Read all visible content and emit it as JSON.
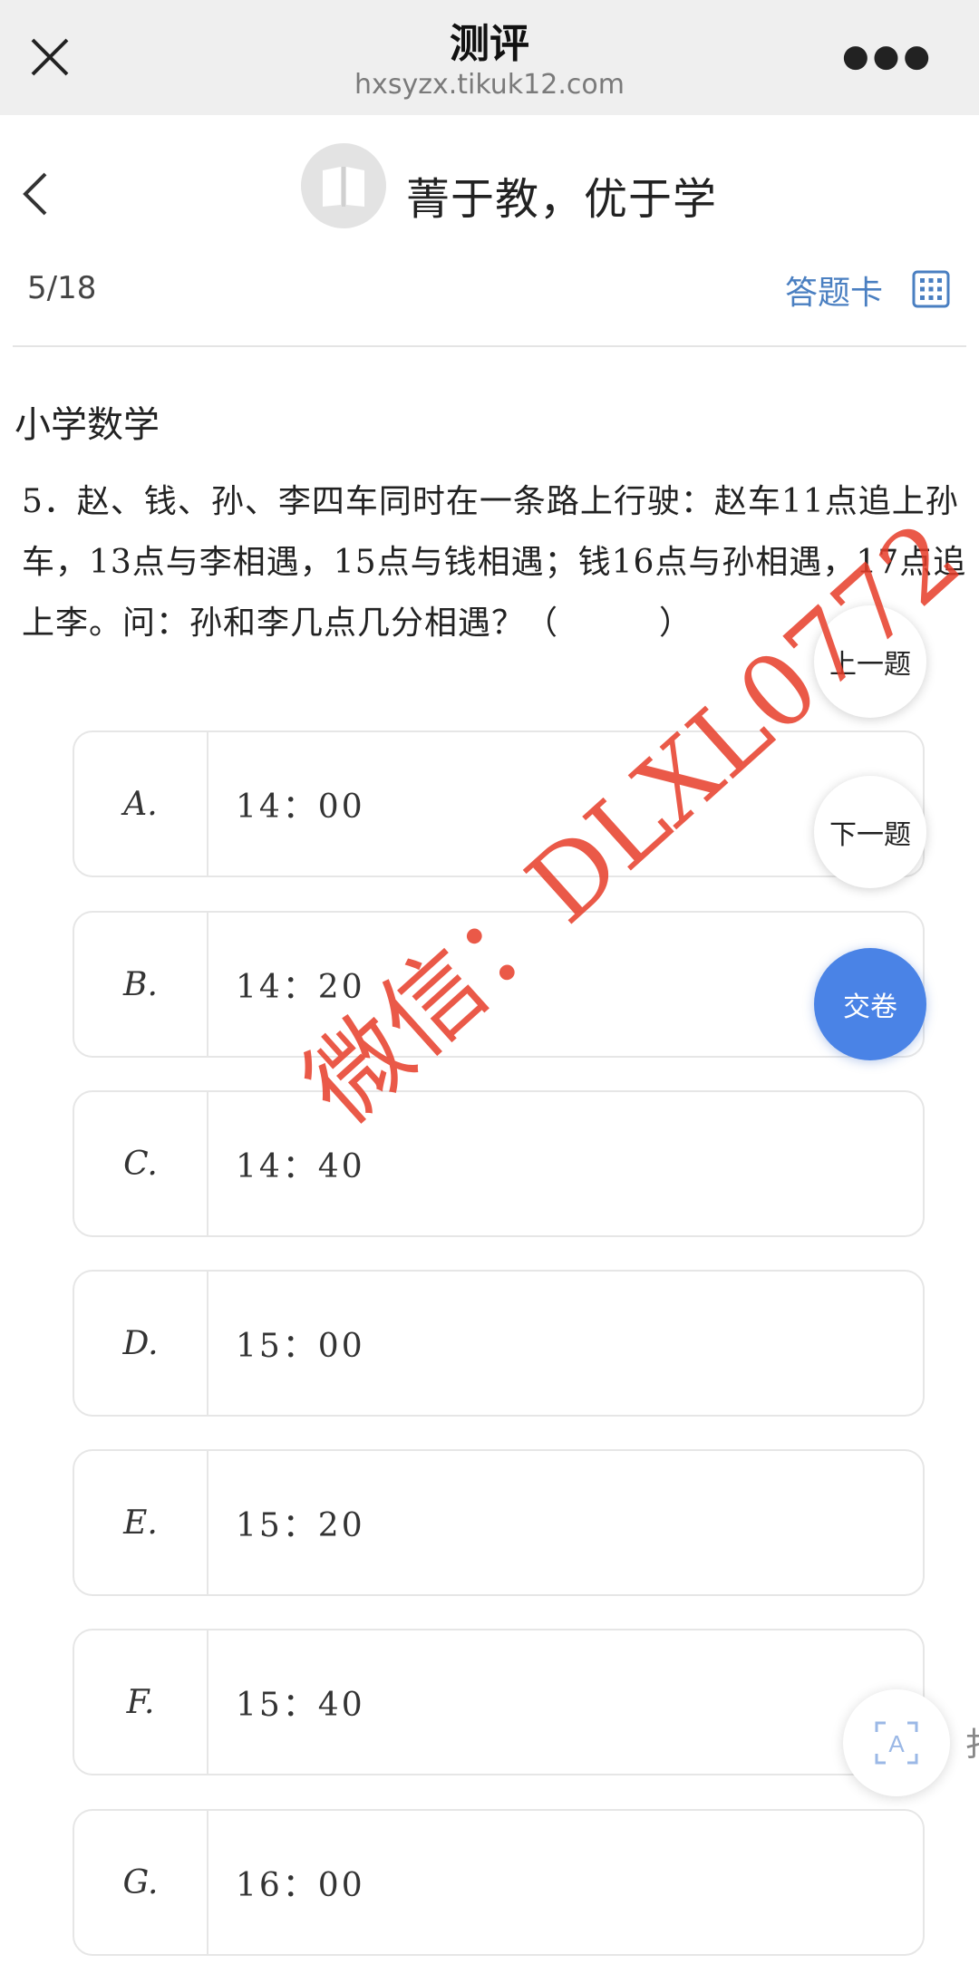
{
  "browser": {
    "title": "测评",
    "url": "hxsyzx.tikuk12.com"
  },
  "header": {
    "slogan": "菁于教，优于学"
  },
  "progress": {
    "current": 5,
    "total": 18,
    "text": "5/18",
    "answer_card_label": "答题卡"
  },
  "subject": "小学数学",
  "question": {
    "text": "5．赵、钱、孙、李四车同时在一条路上行驶：赵车11点追上孙车，13点与李相遇，15点与钱相遇；钱16点与孙相遇，17点追上李。问：孙和李几点几分相遇？（　　　）"
  },
  "options": [
    {
      "letter": "A.",
      "text": "14：00"
    },
    {
      "letter": "B.",
      "text": "14：20"
    },
    {
      "letter": "C.",
      "text": "14：40"
    },
    {
      "letter": "D.",
      "text": "15：00"
    },
    {
      "letter": "E.",
      "text": "15：20"
    },
    {
      "letter": "F.",
      "text": "15：40"
    },
    {
      "letter": "G.",
      "text": "16：00"
    }
  ],
  "nav": {
    "prev": "上一题",
    "next": "下一题",
    "submit": "交卷"
  },
  "watermark": "微信：DLXL0772",
  "fab_side_text": "扌",
  "icons": [
    "close-icon",
    "more-icon",
    "back-icon",
    "book-logo-icon",
    "grid-icon",
    "translate-icon"
  ],
  "colors": {
    "accent": "#4a7fc1",
    "submit": "#4a83e6",
    "watermark": "#e63c28"
  }
}
